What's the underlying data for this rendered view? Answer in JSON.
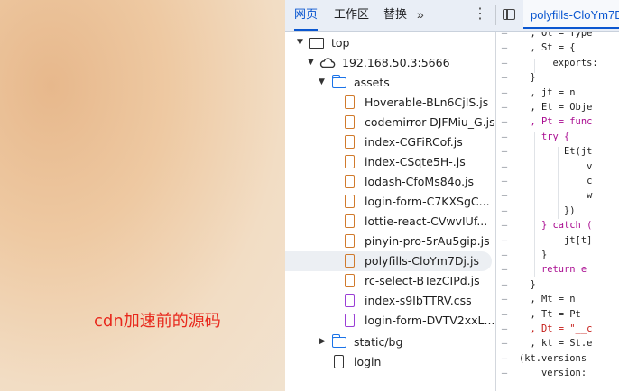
{
  "caption": "cdn加速前的源码",
  "toolbar": {
    "tabs": [
      "网页",
      "工作区",
      "替换"
    ],
    "active_tab": "网页",
    "more_label": "»",
    "menu_label": "⋮",
    "editor_tab": "polyfills-CloYm7D"
  },
  "tree": {
    "top": "top",
    "host": "192.168.50.3:5666",
    "assets_folder": "assets",
    "files": [
      "Hoverable-BLn6CjIS.js",
      "codemirror-DJFMiu_G.js",
      "index-CGFiRCof.js",
      "index-CSqte5H-.js",
      "lodash-CfoMs84o.js",
      "login-form-C7KXSgC...",
      "lottie-react-CVwvIUf...",
      "pinyin-pro-5rAu5gip.js",
      "polyfills-CloYm7Dj.js",
      "rc-select-BTezCIPd.js",
      "index-s9IbTTRV.css",
      "login-form-DVTV2xxL..."
    ],
    "selected_file": "polyfills-CloYm7Dj.js",
    "static_folder": "static/bg",
    "login_doc": "login"
  },
  "code": {
    "dash": "–",
    "lines": [
      "  , Ot = Type",
      "  , St = {",
      "      exports:",
      "  }",
      "  , jt = n",
      "  , Et = Obje",
      "  , Pt = func",
      "    try {",
      "        Et(jt",
      "            v",
      "            c",
      "            w",
      "        })",
      "    } catch (",
      "        jt[t]",
      "    }",
      "    return e",
      "  }",
      "  , Mt = n",
      "  , Tt = Pt",
      "  , Dt = \"__c",
      "  , kt = St.e",
      "(kt.versions",
      "    version:"
    ]
  }
}
